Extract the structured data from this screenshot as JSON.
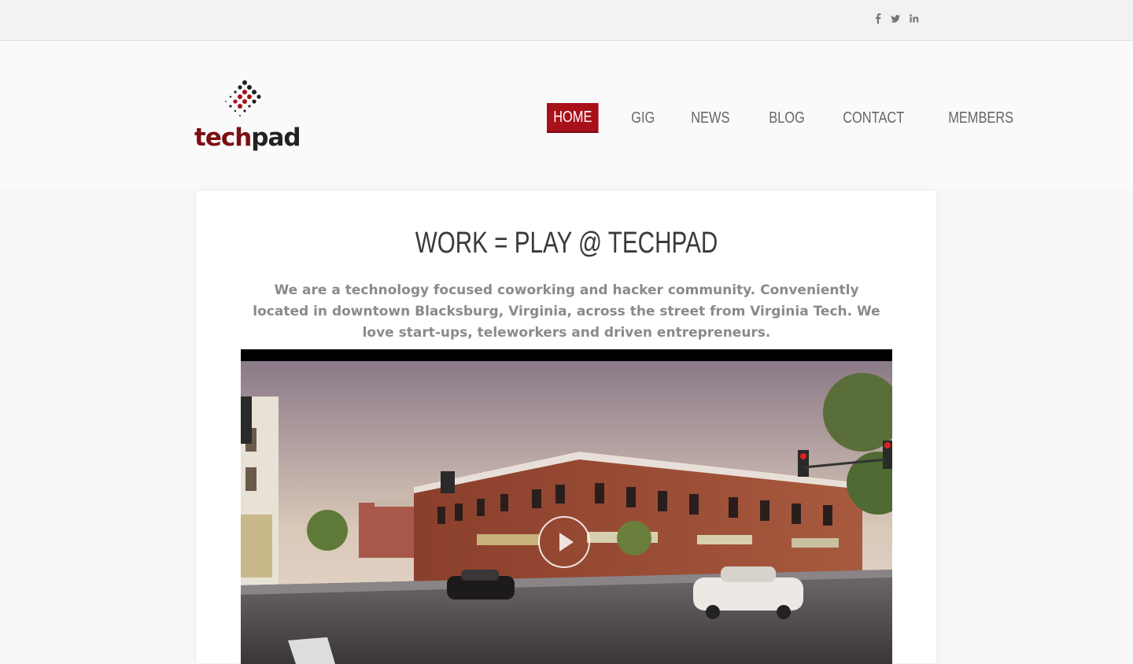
{
  "social": {
    "items": [
      {
        "name": "facebook",
        "label": "f"
      },
      {
        "name": "twitter",
        "label": "t"
      },
      {
        "name": "linkedin",
        "label": "in"
      }
    ]
  },
  "logo": {
    "part1": "tech",
    "part2": "pad"
  },
  "nav": {
    "items": [
      "HOME",
      "GIG",
      "NEWS",
      "BLOG",
      "CONTACT",
      "MEMBERS"
    ],
    "active": "HOME"
  },
  "hero": {
    "title": "WORK = PLAY @ TECHPAD",
    "intro": "We are a technology focused coworking and hacker community. Conveniently located in downtown Blacksburg, Virginia, across the street from Virginia Tech. We love start-ups, teleworkers and driven entrepreneurs."
  },
  "colors": {
    "accent": "#a8101a",
    "logo_red": "#7a0f12",
    "nav_text": "#666666",
    "intro_text": "#8a8a8a"
  }
}
